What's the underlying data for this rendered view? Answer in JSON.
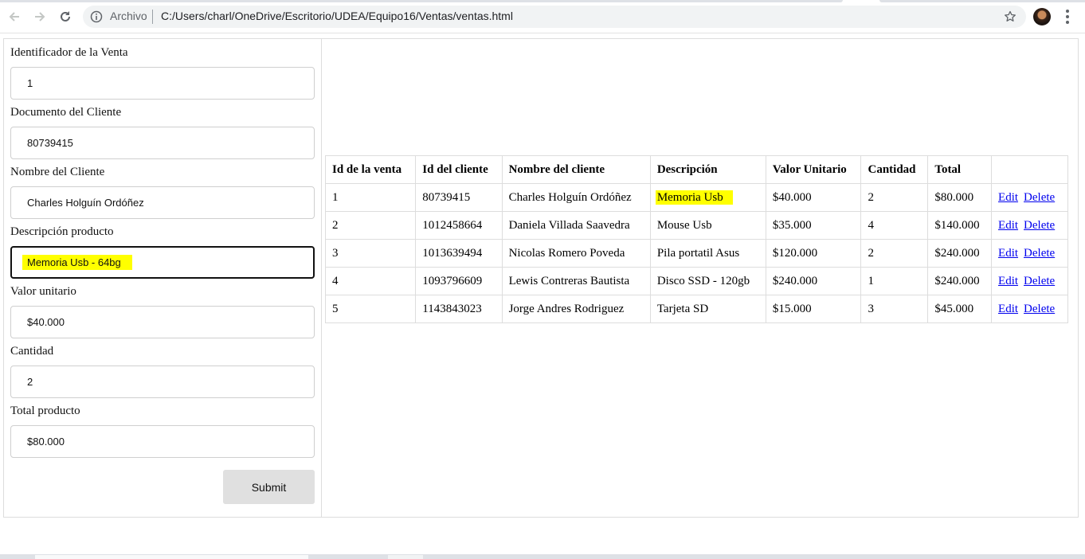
{
  "browser": {
    "site_info_label": "Archivo",
    "url": "C:/Users/charl/OneDrive/Escritorio/UDEA/Equipo16/Ventas/ventas.html"
  },
  "form": {
    "fields": [
      {
        "label": "Identificador de la Venta",
        "value": "1"
      },
      {
        "label": "Documento del Cliente",
        "value": "80739415"
      },
      {
        "label": "Nombre del Cliente",
        "value": "Charles Holguín Ordóñez"
      },
      {
        "label": "Descripción producto",
        "value": "Memoria Usb - 64bg"
      },
      {
        "label": "Valor unitario",
        "value": "$40.000"
      },
      {
        "label": "Cantidad",
        "value": "2"
      },
      {
        "label": "Total producto",
        "value": "$80.000"
      }
    ],
    "submit_label": "Submit"
  },
  "table": {
    "headers": [
      "Id de la venta",
      "Id del cliente",
      "Nombre del cliente",
      "Descripción",
      "Valor Unitario",
      "Cantidad",
      "Total",
      ""
    ],
    "rows": [
      {
        "id": "1",
        "cliente_id": "80739415",
        "nombre": "Charles Holguín Ordóñez",
        "descripcion": "Memoria Usb",
        "valor": "$40.000",
        "cantidad": "2",
        "total": "$80.000"
      },
      {
        "id": "2",
        "cliente_id": "1012458664",
        "nombre": "Daniela Villada Saavedra",
        "descripcion": "Mouse Usb",
        "valor": "$35.000",
        "cantidad": "4",
        "total": "$140.000"
      },
      {
        "id": "3",
        "cliente_id": "1013639494",
        "nombre": "Nicolas Romero Poveda",
        "descripcion": "Pila portatil Asus",
        "valor": "$120.000",
        "cantidad": "2",
        "total": "$240.000"
      },
      {
        "id": "4",
        "cliente_id": "1093796609",
        "nombre": "Lewis Contreras Bautista",
        "descripcion": "Disco SSD - 120gb",
        "valor": "$240.000",
        "cantidad": "1",
        "total": "$240.000"
      },
      {
        "id": "5",
        "cliente_id": "1143843023",
        "nombre": "Jorge Andres Rodriguez",
        "descripcion": "Tarjeta SD",
        "valor": "$15.000",
        "cantidad": "3",
        "total": "$45.000"
      }
    ],
    "edit_label": "Edit",
    "delete_label": "Delete"
  },
  "colors": {
    "highlight": "#ffff00",
    "link": "#0000ee",
    "button_bg": "#e0e0e0"
  }
}
